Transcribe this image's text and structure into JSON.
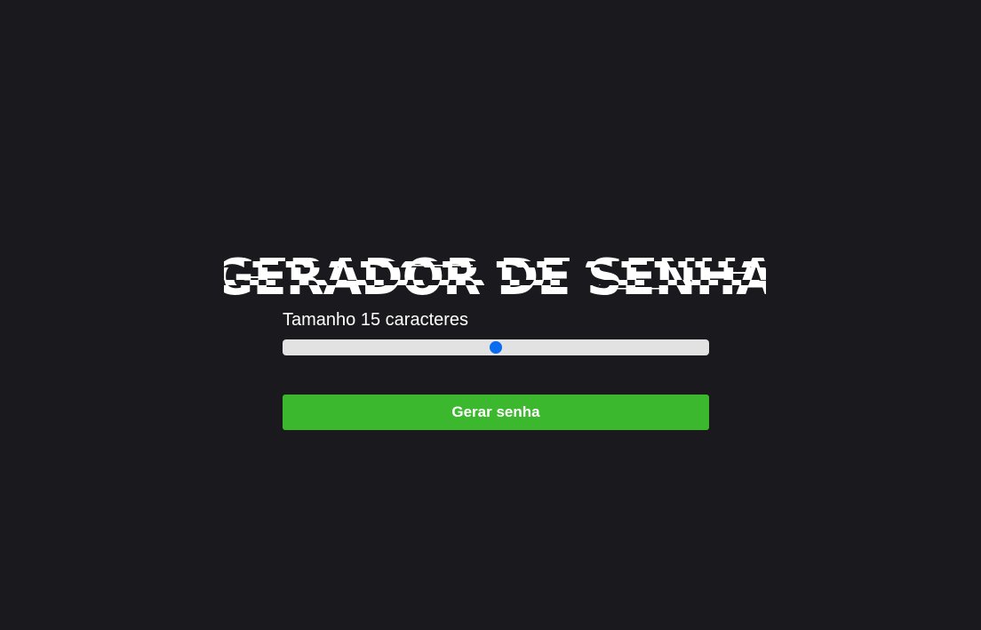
{
  "header": {
    "title": "GERADOR DE SENHA"
  },
  "length_control": {
    "label_prefix": "Tamanho",
    "value_text": "15",
    "label_suffix": "caracteres",
    "fraction": 0.5
  },
  "actions": {
    "generate_label": "Gerar senha"
  },
  "colors": {
    "background": "#1a191e",
    "title": "#ffffff",
    "track": "#e2e2e2",
    "thumb": "#0a6cf0",
    "button": "#3cb82f",
    "button_text": "#ffffff"
  }
}
